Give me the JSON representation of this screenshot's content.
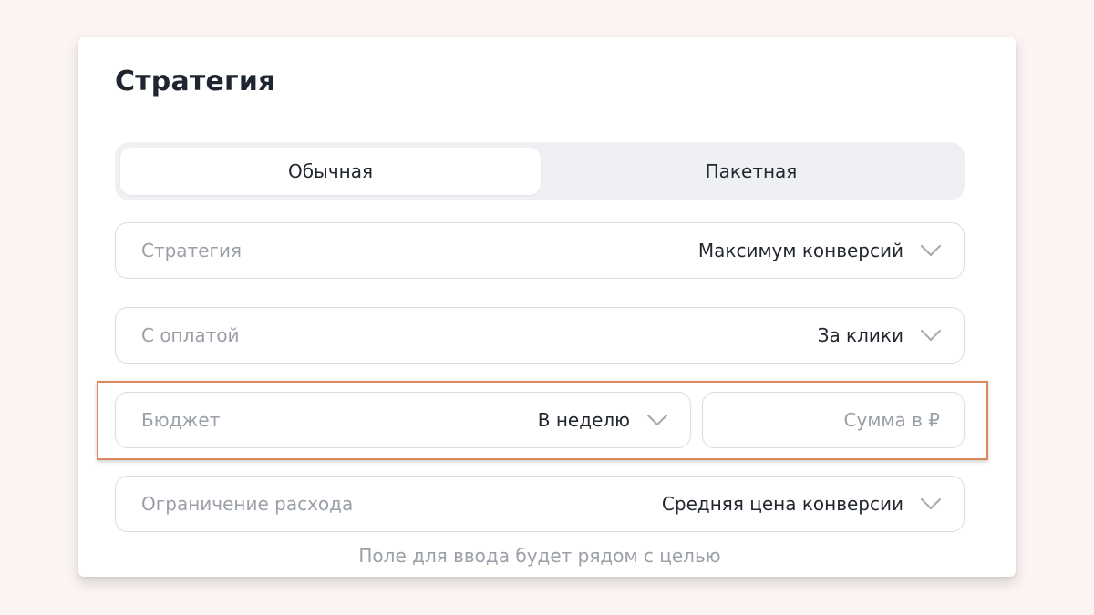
{
  "card": {
    "title": "Стратегия"
  },
  "strategy_type": {
    "options": [
      "Обычная",
      "Пакетная"
    ],
    "selected": "Обычная"
  },
  "fields": {
    "strategy": {
      "label": "Стратегия",
      "value": "Максимум конверсий"
    },
    "payment": {
      "label": "С оплатой",
      "value": "За клики"
    },
    "budget": {
      "label": "Бюджет",
      "value": "В неделю"
    },
    "amount": {
      "placeholder": "Сумма в ₽",
      "value": ""
    },
    "spend_limit": {
      "label": "Ограничение расхода",
      "value": "Средняя цена конверсии"
    }
  },
  "hint": "Поле для ввода будет рядом с целью",
  "colors": {
    "background": "#fbf4f2",
    "highlight_border": "#d9895b",
    "segmented_bg": "#eef0f4",
    "muted_text": "#9a9fa8",
    "text": "#22272f"
  },
  "icons": {
    "dropdown": "chevron-down-icon"
  }
}
